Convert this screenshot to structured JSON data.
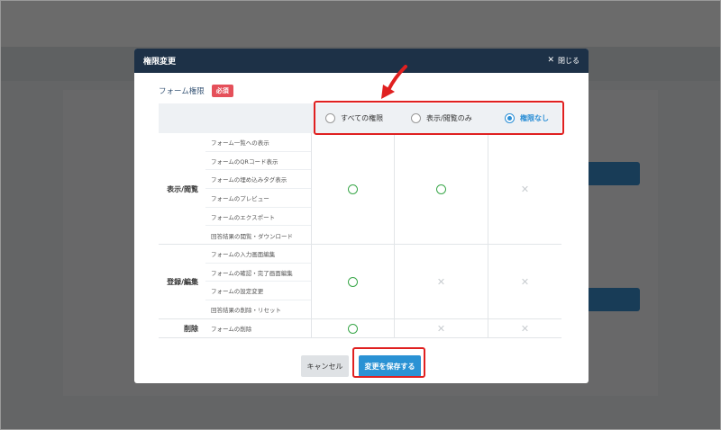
{
  "modal": {
    "title": "権限変更",
    "close_label": "閉じる",
    "field_label": "フォーム権限",
    "required_label": "必須"
  },
  "permission_options": [
    {
      "label": "すべての権限",
      "selected": false
    },
    {
      "label": "表示/閲覧のみ",
      "selected": false
    },
    {
      "label": "権限なし",
      "selected": true
    }
  ],
  "groups": [
    {
      "label": "表示/閲覧",
      "items": [
        "フォーム一覧への表示",
        "フォームのQRコード表示",
        "フォームの埋め込みタグ表示",
        "フォームのプレビュー",
        "フォームのエクスポート",
        "回答結果の閲覧・ダウンロード"
      ],
      "marks": [
        "circle",
        "circle",
        "cross"
      ]
    },
    {
      "label": "登録/編集",
      "items": [
        "フォームの入力画面編集",
        "フォームの確認・完了画面編集",
        "フォームの設定変更",
        "回答結果の削除・リセット"
      ],
      "marks": [
        "circle",
        "cross",
        "cross"
      ]
    },
    {
      "label": "削除",
      "items": [
        "フォームの削除"
      ],
      "marks": [
        "circle",
        "cross",
        "cross"
      ]
    }
  ],
  "footer": {
    "cancel_label": "キャンセル",
    "save_label": "変更を保存する"
  },
  "colors": {
    "header_bg": "#1d3147",
    "accent": "#2a92d4",
    "required": "#e5505a",
    "check": "#3aa74a",
    "annotation": "#e02020"
  },
  "icons": {
    "close": "close-icon",
    "allowed": "circle-icon",
    "denied": "cross-icon",
    "callout": "arrow-icon"
  }
}
